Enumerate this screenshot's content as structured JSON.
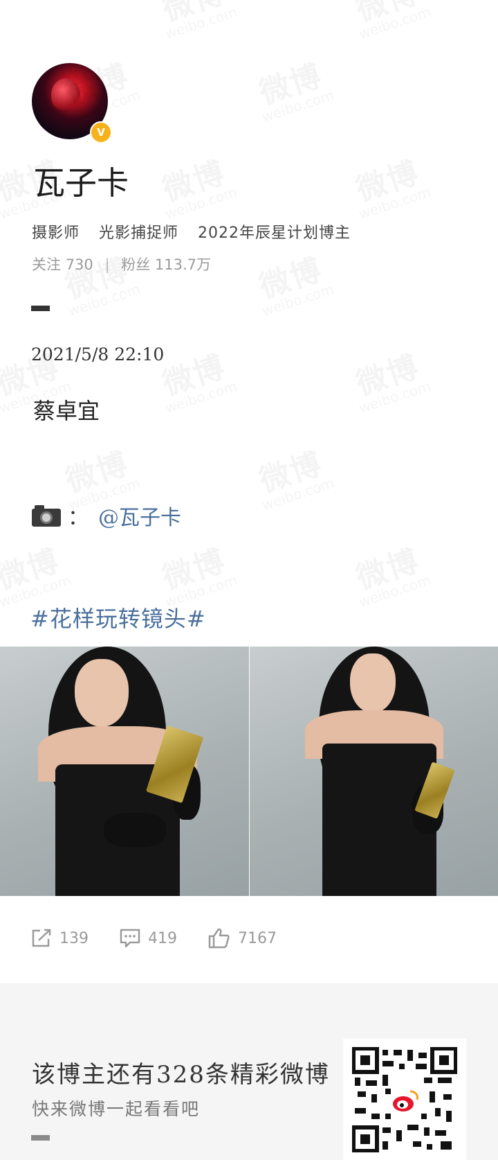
{
  "profile": {
    "username": "瓦子卡",
    "verified_badge": "V",
    "bio_tags": [
      "摄影师",
      "光影捕捉师",
      "2022年辰星计划博主"
    ],
    "following_label": "关注",
    "following_count": "730",
    "followers_label": "粉丝",
    "followers_count": "113.7万"
  },
  "post": {
    "time": "2021/5/8 22:10",
    "text": "蔡卓宜",
    "camera_icon": "camera-icon",
    "colon": "：",
    "mention": "@瓦子卡",
    "topic": "#花样玩转镜头#",
    "photos": [
      {
        "alt": "photo-1"
      },
      {
        "alt": "photo-2"
      }
    ]
  },
  "actions": {
    "repost_count": "139",
    "comment_count": "419",
    "like_count": "7167"
  },
  "footer": {
    "title": "该博主还有328条精彩微博",
    "subtitle": "快来微博一起看看吧"
  },
  "watermark": {
    "cn": "微博",
    "en": "weibo.com"
  },
  "colors": {
    "link": "#4a6f9c",
    "badge": "#f6b21b",
    "muted": "#9a9a9a"
  }
}
